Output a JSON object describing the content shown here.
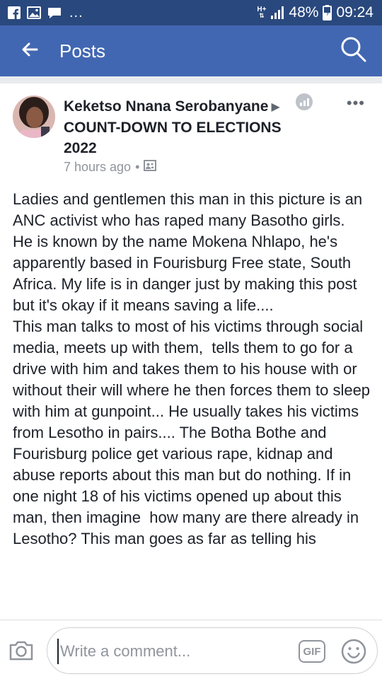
{
  "status_bar": {
    "battery": "48%",
    "time": "09:24",
    "network": "H+",
    "dots": "...",
    "icons": [
      "facebook-icon",
      "gallery-icon",
      "messenger-icon",
      "network-icon",
      "signal-icon",
      "battery-icon"
    ]
  },
  "app_bar": {
    "title": "Posts",
    "icons": [
      "back-arrow-icon",
      "search-icon"
    ]
  },
  "post": {
    "author": "Keketso Nnana Serobanyane",
    "group": "COUNT-DOWN TO ELECTIONS 2022",
    "time": "7 hours ago",
    "separator": "•",
    "more": "•••",
    "icons": [
      "insights-icon",
      "more-options-icon",
      "privacy-icon"
    ],
    "body": "Ladies and gentlemen this man in this picture is an ANC activist who has raped many Basotho girls.\nHe is known by the name Mokena Nhlapo, he's apparently based in Fourisburg Free state, South  Africa. My life is in danger just by making this post but it's okay if it means saving a life....\nThis man talks to most of his victims through social media, meets up with them,  tells them to go for a drive with him and takes them to his house with or without their will where he then forces them to sleep with him at gunpoint... He usually takes his victims from Lesotho in pairs.... The Botha Bothe and Fourisburg police get various rape, kidnap and abuse reports about this man but do nothing. If in one night 18 of his victims opened up about this man, then imagine  how many are there already in Lesotho? This man goes as far as telling his"
  },
  "comment_bar": {
    "placeholder": "Write a comment...",
    "gif_label": "GIF",
    "icons": [
      "camera-icon",
      "gif-icon",
      "emoji-icon"
    ]
  },
  "colors": {
    "status_bar": "#29487d",
    "app_bar": "#4267b2",
    "background": "#e9ebee"
  }
}
